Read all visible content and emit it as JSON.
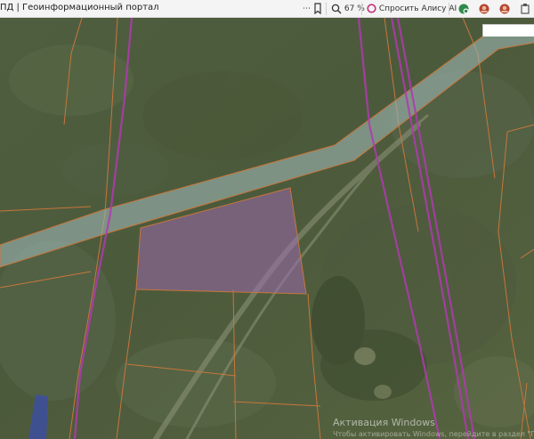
{
  "tab": {
    "title": "ПД | Геоинформационный портал"
  },
  "toolbar": {
    "more_icon": "⋯",
    "bookmark_icon": "bookmark-icon",
    "zoom_level": "67 %",
    "ask_ai_label": "Спросить Алису AI"
  },
  "watermark": {
    "title": "Активация Windows",
    "subtitle": "Чтобы активировать Windows, перейдите в раздел \"Параметры\"."
  },
  "colors": {
    "toolbar_bg": "#f4f4f4",
    "road_fill": "#9bb5b0",
    "selected_parcel": "#a069b4",
    "parcel_border": "#c8763c",
    "boundary_line": "#b03ab0",
    "water_blue": "#3d4fa0"
  }
}
